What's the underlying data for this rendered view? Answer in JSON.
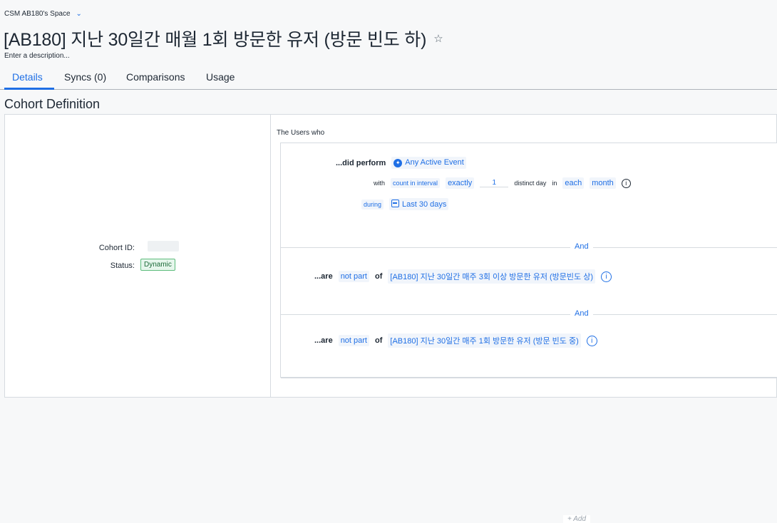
{
  "space": {
    "label": "CSM AB180's Space"
  },
  "header": {
    "title": "[AB180] 지난 30일간 매월 1회 방문한 유저 (방문 빈도 하)",
    "description_placeholder": "Enter a description..."
  },
  "tabs": [
    {
      "label": "Details"
    },
    {
      "label": "Syncs (0)"
    },
    {
      "label": "Comparisons"
    },
    {
      "label": "Usage"
    }
  ],
  "section_title": "Cohort Definition",
  "meta": {
    "cohort_id_label": "Cohort ID:",
    "status_label": "Status:",
    "status_value": "Dynamic"
  },
  "rules": {
    "heading": "The Users who",
    "did_perform": {
      "keyword": "...did perform",
      "event": "Any Active Event",
      "with_label": "with",
      "count_mode": "count in interval",
      "operator": "exactly",
      "count": "1",
      "distinct_label": "distinct day",
      "in_label": "in",
      "each_label": "each",
      "interval": "month",
      "during_label": "during",
      "range": "Last 30 days"
    },
    "and_label": "And",
    "exclusions": [
      {
        "keyword": "...are",
        "mode": "not part",
        "of_label": "of",
        "cohort": "[AB180] 지난 30일간 매주 3회 이상 방문한 유저 (방문빈도 상)"
      },
      {
        "keyword": "...are",
        "mode": "not part",
        "of_label": "of",
        "cohort": "[AB180] 지난 30일간 매주 1회 방문한 유저 (방문 빈도 중)"
      }
    ],
    "add_label": "+ Add"
  }
}
